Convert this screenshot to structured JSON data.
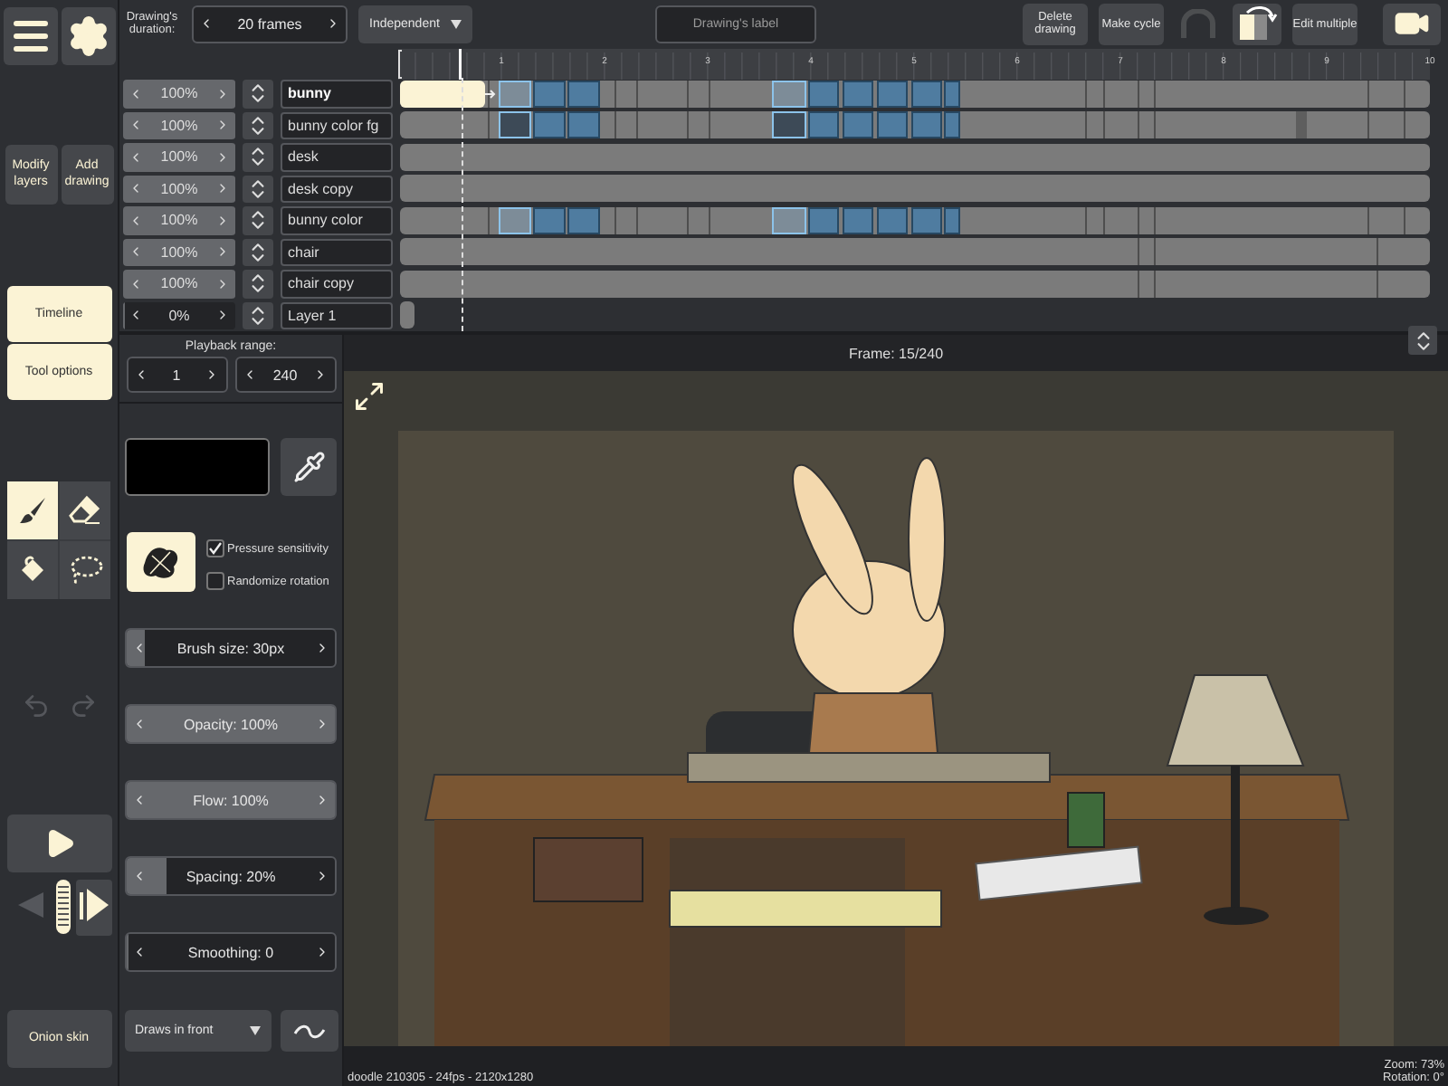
{
  "toolbar": {
    "duration_label": "Drawing's duration:",
    "duration": "20 frames",
    "mode": "Independent",
    "label_field": {
      "placeholder": "Drawing's label"
    },
    "buttons": [
      {
        "kind": "text",
        "label": "Delete drawing",
        "disabled": false
      },
      {
        "kind": "text",
        "label": "Make cycle",
        "disabled": false
      },
      {
        "kind": "arch",
        "disabled": true
      },
      {
        "kind": "flip",
        "disabled": false
      },
      {
        "kind": "text",
        "label": "Edit multiple",
        "disabled": false
      },
      {
        "kind": "camera",
        "disabled": false
      }
    ]
  },
  "ruler": {
    "labels": [
      "1",
      "2",
      "3",
      "4",
      "5",
      "6",
      "7",
      "8",
      "9",
      "10"
    ]
  },
  "layers": [
    {
      "name": "bunny",
      "opacity": "100%",
      "level": 1,
      "selected": true,
      "kind": "animated"
    },
    {
      "name": "bunny color fg",
      "opacity": "100%",
      "level": 1,
      "selected": false,
      "kind": "foreground"
    },
    {
      "name": "desk",
      "opacity": "100%",
      "level": 1,
      "selected": false,
      "kind": "static"
    },
    {
      "name": "desk copy",
      "opacity": "100%",
      "level": 1,
      "selected": false,
      "kind": "static"
    },
    {
      "name": "bunny color",
      "opacity": "100%",
      "level": 1,
      "selected": false,
      "kind": "animated"
    },
    {
      "name": "chair",
      "opacity": "100%",
      "level": 1,
      "selected": false,
      "kind": "split"
    },
    {
      "name": "chair copy",
      "opacity": "100%",
      "level": 1,
      "selected": false,
      "kind": "split"
    },
    {
      "name": "Layer 1",
      "opacity": "0%",
      "level": 0,
      "selected": false,
      "kind": "stub"
    }
  ],
  "sidebar": {
    "layer_buttons": [
      "Modify layers",
      "Add drawing"
    ],
    "panels": [
      {
        "label": "Timeline",
        "selected": true
      },
      {
        "label": "Tool options",
        "selected": true
      }
    ],
    "tools": [
      {
        "kind": "brush",
        "selected": true
      },
      {
        "kind": "eraser",
        "selected": false
      },
      {
        "kind": "fill",
        "selected": false
      },
      {
        "kind": "lasso",
        "selected": false
      }
    ],
    "undo": {
      "disabled": true
    },
    "redo": {
      "disabled": true
    },
    "onion_skin": "Onion skin"
  },
  "tool_options": {
    "playback_label": "Playback range:",
    "range_start": "1",
    "range_end": "240",
    "color": "#000000",
    "checkboxes": [
      {
        "label": "Pressure sensitivity",
        "checked": true
      },
      {
        "label": "Randomize rotation",
        "checked": false
      }
    ],
    "sliders": [
      {
        "label": "Brush size:  30px",
        "level": 0.08
      },
      {
        "label": "Opacity:  100%",
        "level": 1
      },
      {
        "label": "Flow:  100%",
        "level": 1
      },
      {
        "label": "Spacing:  20%",
        "level": 0.18
      },
      {
        "label": "Smoothing:  0",
        "level": 0
      }
    ],
    "draw_mode": "Draws in front"
  },
  "canvas": {
    "frame": "Frame: 15/240"
  },
  "status_bar": {
    "file": "doodle 210305 - 24fps - 2120x1280",
    "zoom": "Zoom: 73%",
    "rotation": "Rotation: 0°"
  }
}
